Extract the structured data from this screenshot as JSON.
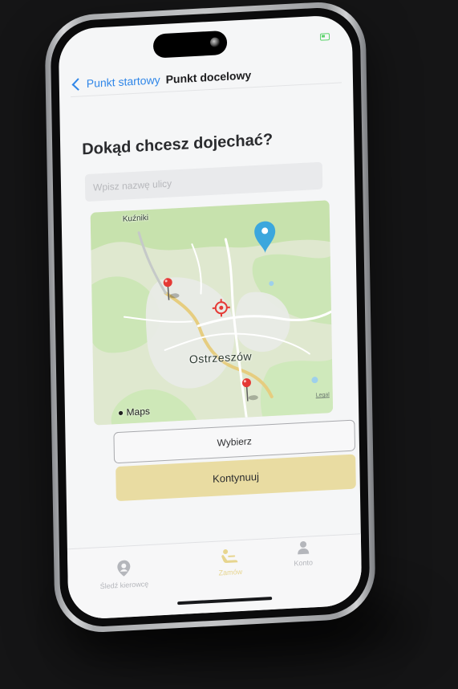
{
  "nav": {
    "back_label": "Punkt startowy",
    "title": "Punkt docelowy"
  },
  "form": {
    "heading": "Dokąd chcesz dojechać?",
    "street_placeholder": "Wpisz nazwę ulicy"
  },
  "map": {
    "city_label": "Ostrzeszów",
    "village_label": "Kuźniki",
    "provider_label": "Maps",
    "legal_label": "Legal",
    "truncated_label": "Ostrzesz"
  },
  "actions": {
    "select_label": "Wybierz",
    "continue_label": "Kontynuuj"
  },
  "tabbar": {
    "items": [
      {
        "label": "Śledź kierowcę",
        "icon": "location-person-icon",
        "active": false
      },
      {
        "label": "Zamów",
        "icon": "seat-icon",
        "active": true
      },
      {
        "label": "Konto",
        "icon": "person-icon",
        "active": false
      }
    ]
  },
  "colors": {
    "accent_blue": "#2f86e8",
    "primary_button": "#e9dca2",
    "active_tab": "#e7d58f",
    "inactive_tab": "#b4b6bb",
    "map_pin_red": "#e53935",
    "map_pin_blue": "#3ba7dd"
  }
}
